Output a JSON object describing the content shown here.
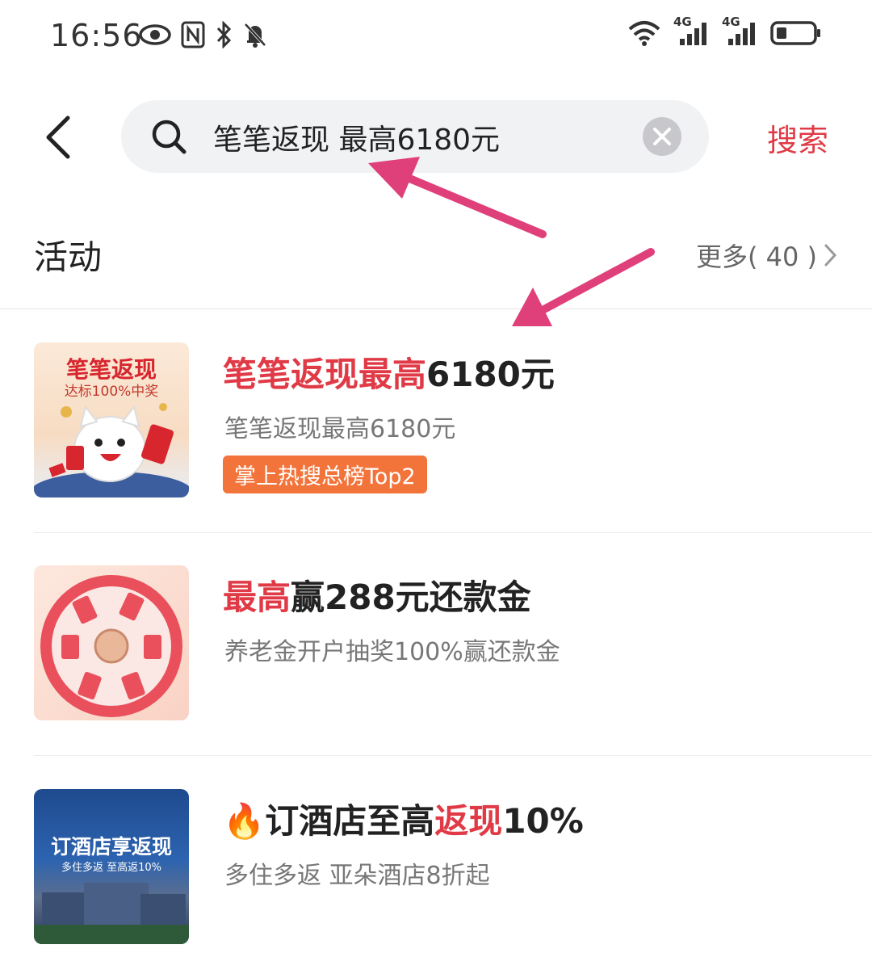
{
  "status_bar": {
    "time": "16:56",
    "icons": [
      "eye-icon",
      "nfc-icon",
      "bluetooth-icon",
      "mute-icon",
      "wifi-icon",
      "signal-4g-icon",
      "signal-4g-icon",
      "battery-icon"
    ],
    "network_label_1": "4G",
    "network_label_2": "4G"
  },
  "search": {
    "query": "笔笔返现 最高6180元",
    "submit_label": "搜索"
  },
  "section": {
    "title": "活动",
    "more_label": "更多( 40 )"
  },
  "items": [
    {
      "title_highlight": "笔笔返现最高",
      "title_rest": "6180元",
      "subtitle": "笔笔返现最高6180元",
      "badge": "掌上热搜总榜Top2",
      "thumb_line1": "笔笔返现",
      "thumb_line2": "达标100%中奖"
    },
    {
      "title_highlight": "最高",
      "title_rest": "赢288元还款金",
      "subtitle": "养老金开户抽奖100%赢还款金"
    },
    {
      "title_prefix": "🔥订酒店至高",
      "title_highlight": "返现",
      "title_rest": "10%",
      "subtitle": "多住多返 亚朵酒店8折起",
      "thumb_line1": "订酒店享返现",
      "thumb_line2": "多住多返 至高返10%"
    }
  ],
  "colors": {
    "accent": "#e03a46",
    "badge": "#f3743a",
    "annotation_arrow": "#e0407a"
  }
}
